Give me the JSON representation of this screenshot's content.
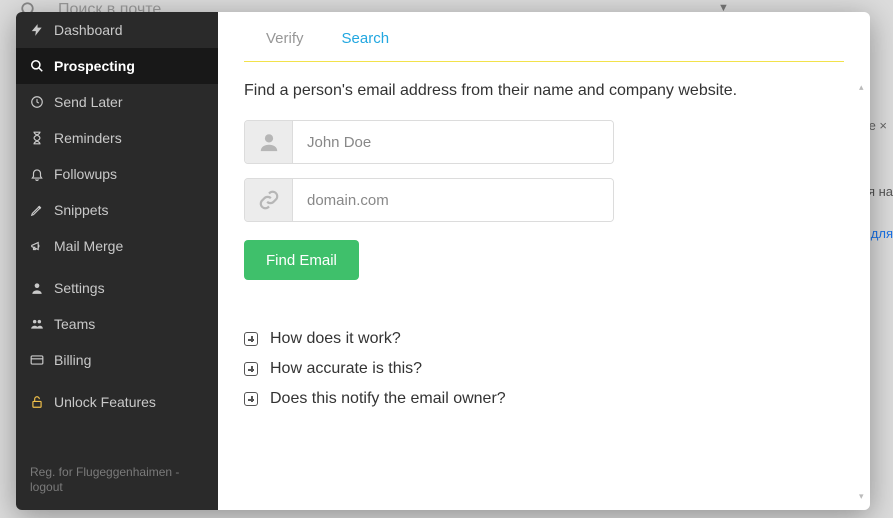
{
  "background": {
    "search_placeholder": "Поиск в почте",
    "close_x": "e ×",
    "txt1": "я на",
    "txt2": "для"
  },
  "sidebar": {
    "items": [
      {
        "label": "Dashboard"
      },
      {
        "label": "Prospecting"
      },
      {
        "label": "Send Later"
      },
      {
        "label": "Reminders"
      },
      {
        "label": "Followups"
      },
      {
        "label": "Snippets"
      },
      {
        "label": "Mail Merge"
      },
      {
        "label": "Settings"
      },
      {
        "label": "Teams"
      },
      {
        "label": "Billing"
      },
      {
        "label": "Unlock Features"
      }
    ],
    "footer": "Reg. for Flugeggenhaimen - logout"
  },
  "tabs": {
    "verify": "Verify",
    "search": "Search"
  },
  "main": {
    "description": "Find a person's email address from their name and company website.",
    "name_placeholder": "John Doe",
    "domain_placeholder": "domain.com",
    "find_button": "Find Email"
  },
  "faq": [
    "How does it work?",
    "How accurate is this?",
    "Does this notify the email owner?"
  ],
  "colors": {
    "accent": "#22a7e0",
    "action": "#3fc06b",
    "unlock": "#f0c04a"
  }
}
